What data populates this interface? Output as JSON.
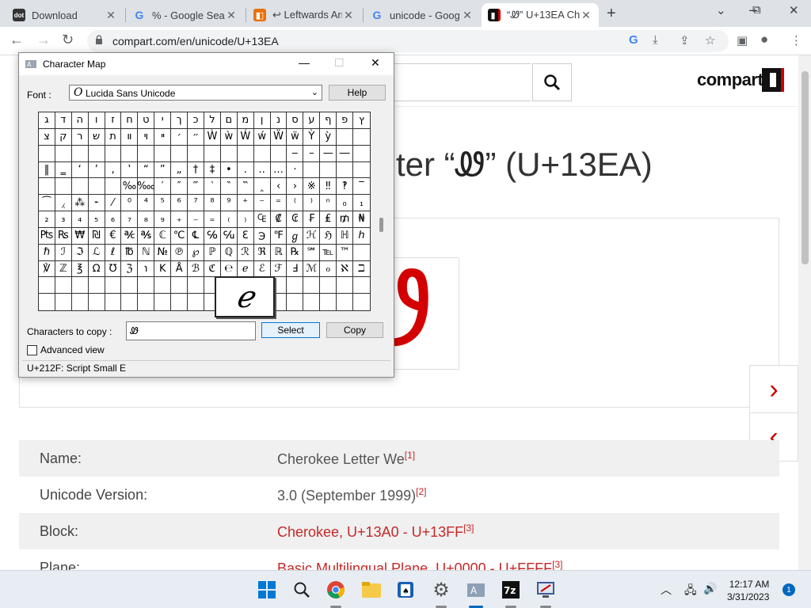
{
  "browser": {
    "tabs": [
      {
        "title": "Download",
        "favicon": "dot",
        "favicon_color": "#333333"
      },
      {
        "title": "% - Google Sea",
        "favicon": "G",
        "favicon_color": "#4285f4"
      },
      {
        "title": "↩ Leftwards Arr",
        "favicon": "compart",
        "favicon_color": "#e8710a"
      },
      {
        "title": "unicode - Goog",
        "favicon": "G",
        "favicon_color": "#4285f4"
      },
      {
        "title": "“Ꮺ” U+13EA Ch",
        "favicon": "compart",
        "favicon_color": "#c00000"
      }
    ],
    "new_tab": "+",
    "window_controls": {
      "minimize": "⌄",
      "restore": "⧉",
      "close": "✕"
    },
    "url": "compart.com/en/unicode/U+13EA"
  },
  "page": {
    "title_prefix": "ter “",
    "title_glyph": "Ꮺ",
    "title_suffix": "” (U+13EA)",
    "logo": "compart",
    "big_glyph": "Ꮺ",
    "next_arrow": "›",
    "prev_arrow": "‹",
    "info": [
      {
        "key": "Name:",
        "value": "Cherokee Letter We",
        "ref": "[1]",
        "link": false
      },
      {
        "key": "Unicode Version:",
        "value": "3.0 (September 1999)",
        "ref": "[2]",
        "link": false
      },
      {
        "key": "Block:",
        "value": "Cherokee, U+13A0 - U+13FF",
        "ref": "[3]",
        "link": true
      },
      {
        "key": "Plane:",
        "value": "Basic Multilingual Plane, U+0000 - U+FFFF",
        "ref": "[3]",
        "link": true
      }
    ]
  },
  "charmap": {
    "title": "Character Map",
    "font_label": "Font :",
    "font_name": "Lucida Sans Unicode",
    "help_label": "Help",
    "chars_to_copy_label": "Characters to copy :",
    "chars_to_copy_value": "Ꮺ",
    "select_label": "Select",
    "copy_label": "Copy",
    "advanced_view_label": "Advanced view",
    "status": "U+212F: Script Small E",
    "zoom_char": "ℯ",
    "grid": [
      [
        "ג",
        "ד",
        "ה",
        "ו",
        "ז",
        "ח",
        "ט",
        "י",
        "ך",
        "כ",
        "ל",
        "ם",
        "מ",
        "ן",
        "נ",
        "ס",
        "ע",
        "ף",
        "פ",
        "ץ"
      ],
      [
        "צ",
        "ק",
        "ר",
        "ש",
        "ת",
        "װ",
        "ױ",
        "ײ",
        "׳",
        "״",
        "Ẁ",
        "ẁ",
        "Ẃ",
        "ẃ",
        "Ẅ",
        "ẅ",
        "Ỳ",
        "ỳ",
        "",
        ""
      ],
      [
        "",
        "",
        "",
        "",
        "",
        "",
        "",
        "",
        "",
        "",
        "",
        "",
        "",
        "",
        "",
        "‒",
        "–",
        "—",
        "―",
        ""
      ],
      [
        "‖",
        "‗",
        "‘",
        "’",
        "‚",
        "‛",
        "“",
        "”",
        "„",
        "†",
        "‡",
        "•",
        "․",
        "‥",
        "…",
        "‧",
        "",
        "",
        "",
        ""
      ],
      [
        "",
        "",
        "",
        "",
        "",
        "‰",
        "‱",
        "′",
        "″",
        "‴",
        "‵",
        "‶",
        "‷",
        "‸",
        "‹",
        "›",
        "※",
        "‼",
        "‽",
        "‾"
      ],
      [
        "⁀",
        "⁁",
        "⁂",
        "⁃",
        "⁄",
        "⁰",
        "⁴",
        "⁵",
        "⁶",
        "⁷",
        "⁸",
        "⁹",
        "⁺",
        "⁻",
        "⁼",
        "⁽",
        "⁾",
        "ⁿ",
        "₀",
        "₁"
      ],
      [
        "₂",
        "₃",
        "₄",
        "₅",
        "₆",
        "₇",
        "₈",
        "₉",
        "₊",
        "₋",
        "₌",
        "₍",
        "₎",
        "₠",
        "₡",
        "₢",
        "₣",
        "₤",
        "₥",
        "₦"
      ],
      [
        "₧",
        "₨",
        "₩",
        "₪",
        "€",
        "℀",
        "℁",
        "ℂ",
        "℃",
        "℄",
        "℅",
        "℆",
        "ℇ",
        "℈",
        "℉",
        "ℊ",
        "ℋ",
        "ℌ",
        "ℍ",
        "ℎ"
      ],
      [
        "ℏ",
        "ℐ",
        "ℑ",
        "ℒ",
        "ℓ",
        "℔",
        "ℕ",
        "№",
        "℗",
        "℘",
        "ℙ",
        "ℚ",
        "ℛ",
        "ℜ",
        "ℝ",
        "℞",
        "℠",
        "℡",
        "™",
        ""
      ],
      [
        "℣",
        "ℤ",
        "℥",
        "Ω",
        "℧",
        "ℨ",
        "℩",
        "K",
        "Å",
        "ℬ",
        "ℭ",
        "℮",
        "ℯ",
        "ℰ",
        "ℱ",
        "Ⅎ",
        "ℳ",
        "ℴ",
        "ℵ",
        "ℶ"
      ],
      [
        "",
        "",
        "",
        "",
        "",
        "",
        "",
        "",
        "",
        "",
        "",
        "",
        "",
        "",
        "",
        "",
        "",
        "",
        "",
        ""
      ],
      [
        "",
        "",
        "",
        "",
        "",
        "",
        "",
        "",
        "",
        "",
        "",
        "",
        "",
        "",
        "",
        "",
        "",
        "",
        "",
        ""
      ]
    ]
  },
  "taskbar": {
    "apps": [
      "start-icon",
      "search-icon",
      "chrome-icon",
      "file-explorer-icon",
      "solitaire-icon",
      "settings-icon",
      "character-map-icon",
      "7zip-icon",
      "screen-tool-icon"
    ],
    "clock_time": "12:17 AM",
    "clock_date": "3/31/2023",
    "notifications": "1"
  }
}
